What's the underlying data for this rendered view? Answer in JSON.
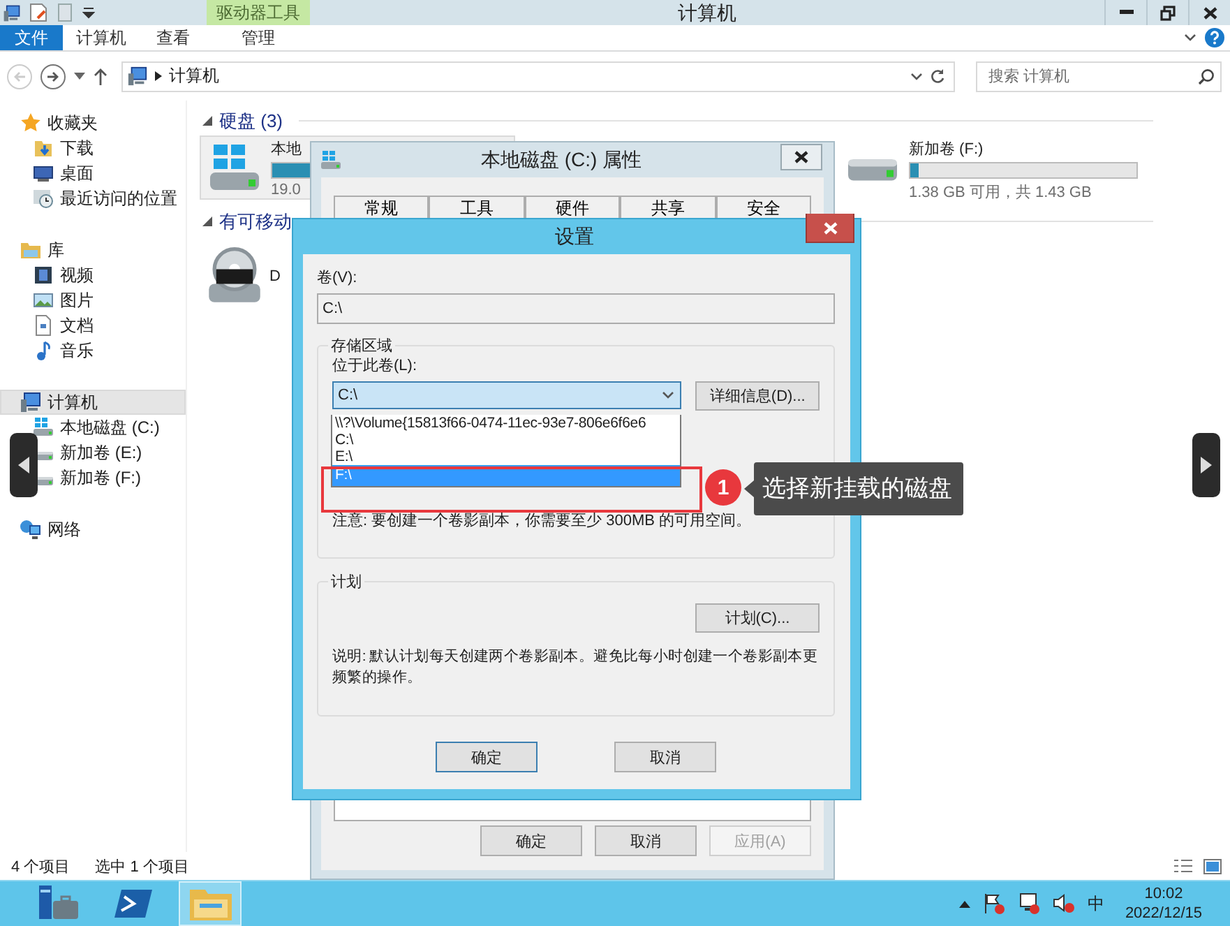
{
  "explorer": {
    "title": "计算机",
    "tool_group": "驱动器工具",
    "ribbon_tabs": [
      {
        "label": "文件",
        "kind": "file",
        "selected": false
      },
      {
        "label": "计算机",
        "kind": "tab",
        "selected": false
      },
      {
        "label": "查看",
        "kind": "tab",
        "selected": false
      },
      {
        "label": "管理",
        "kind": "tool",
        "selected": false
      }
    ],
    "address": "计算机",
    "search": {
      "placeholder": "搜索 计算机"
    },
    "nav": [
      {
        "label": "收藏夹",
        "kind": "star",
        "selected": false,
        "children": [
          {
            "label": "下载",
            "kind": "download",
            "selected": false
          },
          {
            "label": "桌面",
            "kind": "desktop",
            "selected": false
          },
          {
            "label": "最近访问的位置",
            "kind": "recent",
            "selected": false
          }
        ]
      },
      {
        "label": "库",
        "kind": "library",
        "selected": false,
        "children": [
          {
            "label": "视频",
            "kind": "video",
            "selected": false
          },
          {
            "label": "图片",
            "kind": "picture",
            "selected": false
          },
          {
            "label": "文档",
            "kind": "document",
            "selected": false
          },
          {
            "label": "音乐",
            "kind": "music",
            "selected": false
          }
        ]
      },
      {
        "label": "计算机",
        "kind": "computer",
        "selected": true,
        "children": [
          {
            "label": "本地磁盘 (C:)",
            "kind": "system-drive",
            "selected": false
          },
          {
            "label": "新加卷 (E:)",
            "kind": "drive",
            "selected": false
          },
          {
            "label": "新加卷 (F:)",
            "kind": "drive",
            "selected": false
          }
        ]
      },
      {
        "label": "网络",
        "kind": "network",
        "selected": false
      }
    ],
    "sections": [
      {
        "title": "硬盘 (3)",
        "expanded": true,
        "items": [
          {
            "name": "本地",
            "kind": "system-drive",
            "selected": true,
            "level": 0.6,
            "info": "19.0"
          },
          {
            "name": "新加卷 (F:)",
            "kind": "drive",
            "selected": false,
            "level": 0.04,
            "info": "1.38 GB 可用，共 1.43 GB"
          }
        ]
      },
      {
        "title": "有可移动",
        "expanded": true,
        "items": [
          {
            "name": "D",
            "kind": "dvd",
            "selected": false
          }
        ]
      }
    ],
    "status_bar": {
      "count": "4 个项目",
      "selection": "选中 1 个项目"
    }
  },
  "properties": {
    "title": "本地磁盘 (C:) 属性",
    "tabs": [
      {
        "label": "常规",
        "selected": false
      },
      {
        "label": "工具",
        "selected": false
      },
      {
        "label": "硬件",
        "selected": false
      },
      {
        "label": "共享",
        "selected": false
      },
      {
        "label": "安全",
        "selected": false
      }
    ],
    "buttons": [
      {
        "label": "确定",
        "disabled": false
      },
      {
        "label": "取消",
        "disabled": false
      },
      {
        "label": "应用(A)",
        "disabled": true
      }
    ]
  },
  "settings": {
    "title": "设置",
    "volume_label": "卷(V):",
    "volume": "C:\\",
    "storage": {
      "title": "存储区域",
      "location_label": "位于此卷(L):",
      "location": "C:\\",
      "details_button": "详细信息(D)...",
      "options": [
        {
          "label": "\\\\?\\Volume{15813f66-0474-11ec-93e7-806e6f6e6",
          "selected": false
        },
        {
          "label": "C:\\",
          "selected": false
        },
        {
          "label": "E:\\",
          "selected": false
        },
        {
          "label": "F:\\",
          "selected": true
        }
      ],
      "note": "注意: 要创建一个卷影副本，你需要至少 300MB 的可用空间。"
    },
    "schedule": {
      "title": "计划",
      "button": "计划(C)...",
      "description": "说明: 默认计划每天创建两个卷影副本。避免比每小时创建一个卷影副本更频繁的操作。"
    },
    "buttons": [
      {
        "label": "确定",
        "default": true
      },
      {
        "label": "取消",
        "default": false
      }
    ]
  },
  "annotation": {
    "number": "1",
    "text": "选择新挂载的磁盘"
  },
  "taskbar": {
    "apps": [
      {
        "kind": "server-manager",
        "active": false
      },
      {
        "kind": "powershell",
        "active": false
      },
      {
        "kind": "explorer",
        "active": true
      }
    ],
    "ime": "中",
    "time": "10:02",
    "date": "2022/12/15"
  }
}
